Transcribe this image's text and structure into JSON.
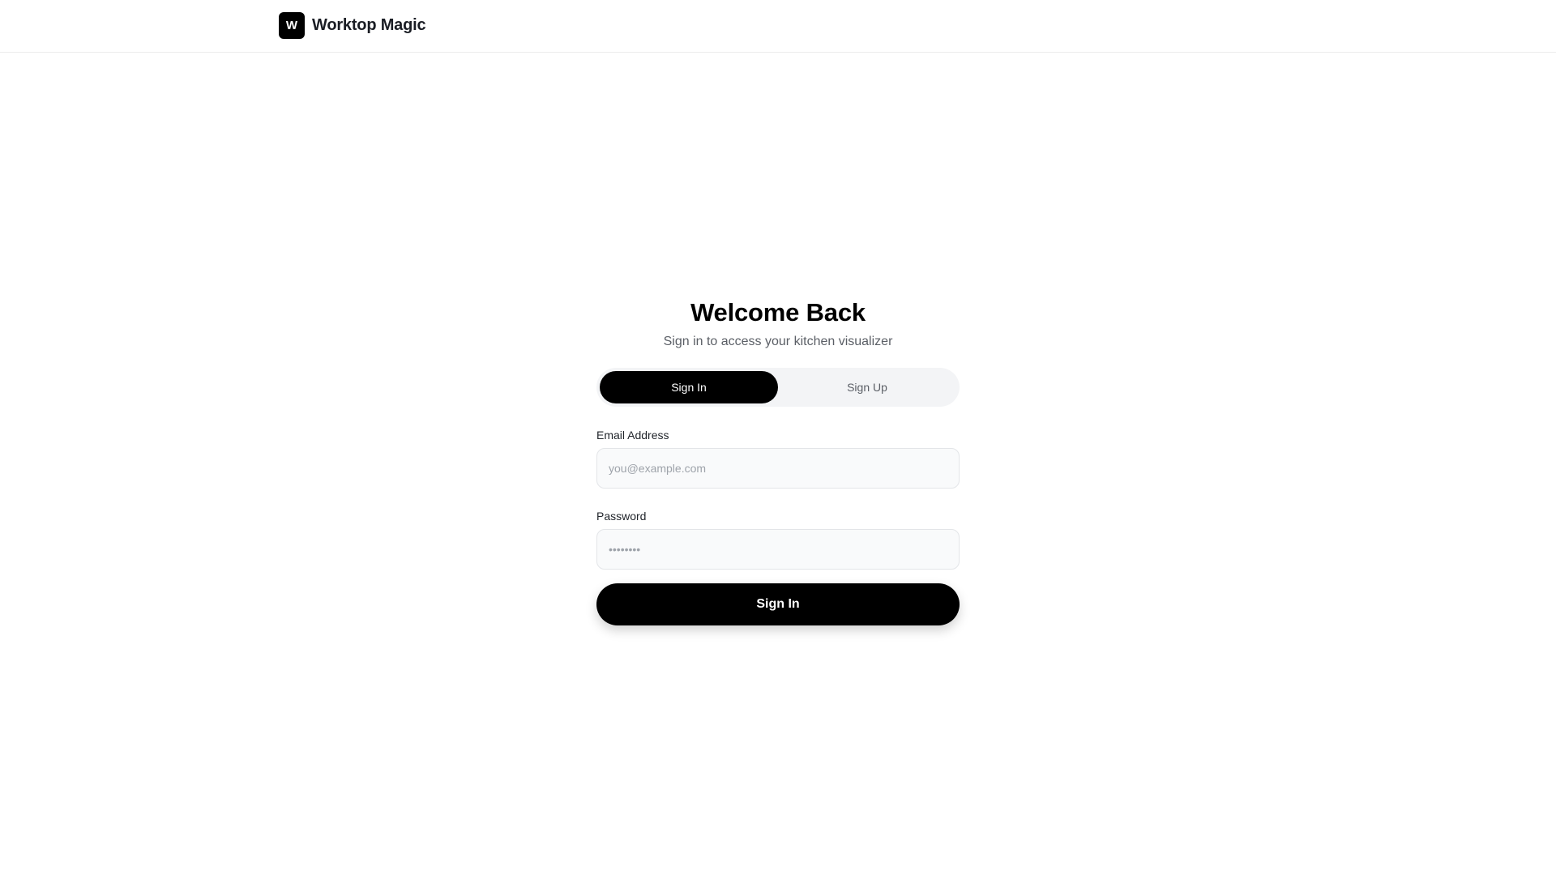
{
  "header": {
    "logo_letter": "W",
    "app_name": "Worktop Magic"
  },
  "auth": {
    "title": "Welcome Back",
    "subtitle": "Sign in to access your kitchen visualizer",
    "tabs": [
      {
        "label": "Sign In",
        "active": true
      },
      {
        "label": "Sign Up",
        "active": false
      }
    ],
    "email": {
      "label": "Email Address",
      "placeholder": "you@example.com",
      "value": ""
    },
    "password": {
      "label": "Password",
      "placeholder": "••••••••",
      "value": ""
    },
    "submit_label": "Sign In"
  },
  "colors": {
    "primary": "#000000",
    "background": "#ffffff",
    "input_bg": "#f9fafb",
    "muted_text": "#5b5f66",
    "tab_track": "#f3f4f6"
  }
}
